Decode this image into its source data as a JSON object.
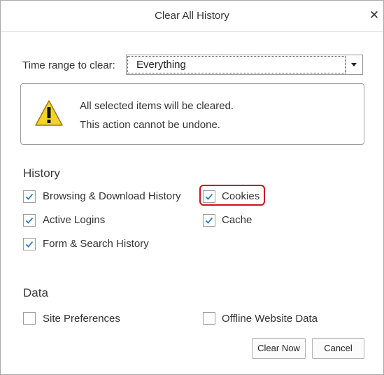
{
  "dialog": {
    "title": "Clear All History",
    "close_glyph": "✕"
  },
  "time_range": {
    "label": "Time range to clear:",
    "selected": "Everything"
  },
  "warning": {
    "icon": "warning-triangle-icon",
    "line1": "All selected items will be cleared.",
    "line2": "This action cannot be undone."
  },
  "history": {
    "heading": "History",
    "items": [
      {
        "label": "Browsing & Download History",
        "checked": true
      },
      {
        "label": "Cookies",
        "checked": true
      },
      {
        "label": "Active Logins",
        "checked": true
      },
      {
        "label": "Cache",
        "checked": true
      },
      {
        "label": "Form & Search History",
        "checked": true
      }
    ]
  },
  "data": {
    "heading": "Data",
    "items": [
      {
        "label": "Site Preferences",
        "checked": false
      },
      {
        "label": "Offline Website Data",
        "checked": false
      }
    ]
  },
  "buttons": {
    "clear_now": "Clear Now",
    "cancel": "Cancel"
  },
  "colors": {
    "checkmark": "#1f73b7",
    "highlight": "#c8131c",
    "warning_fill": "#f5d228"
  }
}
